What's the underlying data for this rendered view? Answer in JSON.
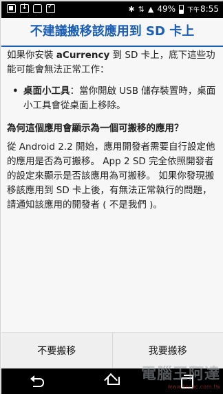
{
  "status_bar": {
    "left_icons": [
      "image-icon",
      "download-icon",
      "bag-icon",
      "check-icon"
    ],
    "right_icons": [
      "bluetooth-icon",
      "network-4g-icon",
      "signal-icon"
    ],
    "battery": "49%",
    "time_period": "下午",
    "time": "8:55"
  },
  "dialog": {
    "title": "不建議搬移該應用到 SD 卡上",
    "intro_pre": "如果你安裝 ",
    "app_name": "aCurrency",
    "intro_post": " 到 SD 卡上，底下這些功能可能會無法正常工作：",
    "bullet_label": "桌面小工具",
    "bullet_text": "：當你開啟 USB 儲存裝置時，桌面小工具會從桌面上移除。",
    "question": "為何這個應用會顯示為一個可搬移的應用？",
    "explanation": "從 Android 2.2 開始，應用開發者需要自行設定他的應用是否為可搬移。 App 2 SD 完全依照開發者的設定來顯示是否該應用為可搬移。 如果你發現搬移該應用到 SD 卡上後，有無法正常執行的問題， 請通知該應用的開發者 ( 不是我們 )。",
    "buttons": {
      "cancel": "不要搬移",
      "confirm": "我要搬移"
    }
  },
  "nav_bar": {
    "icons": [
      "back-icon",
      "home-icon",
      "recent-apps-icon"
    ]
  },
  "watermark": {
    "big": "電腦王阿達",
    "small": "www.kocpc.com.tw"
  }
}
